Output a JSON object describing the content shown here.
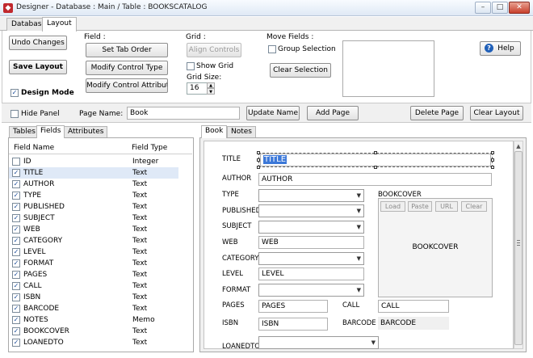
{
  "window": {
    "title": "Designer - Database : Main / Table : BOOKSCATALOG",
    "min": "–",
    "max": "□",
    "close": "✕"
  },
  "tabs": [
    {
      "label": "Database"
    },
    {
      "label": "Layout"
    }
  ],
  "ribbon": {
    "undo": "Undo Changes",
    "save": "Save Layout",
    "design_mode": "Design Mode",
    "field_group": "Field :",
    "set_tab_order": "Set Tab Order",
    "modify_control_type": "Modify Control Type",
    "modify_control_attributes": "Modify Control Attributes",
    "grid_group": "Grid :",
    "align_controls": "Align Controls",
    "show_grid": "Show Grid",
    "grid_size_label": "Grid Size:",
    "grid_size_value": "16",
    "move_group": "Move Fields :",
    "group_selection": "Group Selection",
    "clear_selection": "Clear Selection",
    "help": "Help"
  },
  "panelbar": {
    "hide_panel": "Hide Panel",
    "page_name_label": "Page Name:",
    "page_name_value": "Book",
    "update_name": "Update Name",
    "add_page": "Add Page",
    "delete_page": "Delete Page",
    "clear_layout": "Clear Layout"
  },
  "left_tabs": [
    {
      "label": "Tables"
    },
    {
      "label": "Fields"
    },
    {
      "label": "Attributes"
    }
  ],
  "fields_table": {
    "col_name": "Field Name",
    "col_type": "Field Type",
    "rows": [
      {
        "name": "ID",
        "type": "Integer",
        "checked": false
      },
      {
        "name": "TITLE",
        "type": "Text",
        "checked": true
      },
      {
        "name": "AUTHOR",
        "type": "Text",
        "checked": true
      },
      {
        "name": "TYPE",
        "type": "Text",
        "checked": true
      },
      {
        "name": "PUBLISHED",
        "type": "Text",
        "checked": true
      },
      {
        "name": "SUBJECT",
        "type": "Text",
        "checked": true
      },
      {
        "name": "WEB",
        "type": "Text",
        "checked": true
      },
      {
        "name": "CATEGORY",
        "type": "Text",
        "checked": true
      },
      {
        "name": "LEVEL",
        "type": "Text",
        "checked": true
      },
      {
        "name": "FORMAT",
        "type": "Text",
        "checked": true
      },
      {
        "name": "PAGES",
        "type": "Text",
        "checked": true
      },
      {
        "name": "CALL",
        "type": "Text",
        "checked": true
      },
      {
        "name": "ISBN",
        "type": "Text",
        "checked": true
      },
      {
        "name": "BARCODE",
        "type": "Text",
        "checked": true
      },
      {
        "name": "NOTES",
        "type": "Memo",
        "checked": true
      },
      {
        "name": "BOOKCOVER",
        "type": "Text",
        "checked": true
      },
      {
        "name": "LOANEDTO",
        "type": "Text",
        "checked": true
      }
    ]
  },
  "right_tabs": [
    {
      "label": "Book"
    },
    {
      "label": "Notes"
    }
  ],
  "form": {
    "title_label": "TITLE",
    "title_value": "TITLE",
    "author_label": "AUTHOR",
    "author_value": "AUTHOR",
    "type_label": "TYPE",
    "published_label": "PUBLISHED",
    "subject_label": "SUBJECT",
    "web_label": "WEB",
    "web_value": "WEB",
    "category_label": "CATEGORY",
    "level_label": "LEVEL",
    "level_value": "LEVEL",
    "format_label": "FORMAT",
    "pages_label": "PAGES",
    "pages_value": "PAGES",
    "isbn_label": "ISBN",
    "isbn_value": "ISBN",
    "call_label": "CALL",
    "call_value": "CALL",
    "barcode_label": "BARCODE",
    "barcode_value": "BARCODE",
    "loanedto_label": "LOANEDTO",
    "bookcover_label": "BOOKCOVER",
    "bookcover_placeholder": "BOOKCOVER",
    "load": "Load",
    "paste": "Paste",
    "url": "URL",
    "clear": "Clear"
  },
  "glyphs": {
    "check": "✓",
    "dropdown": "▼",
    "up": "▲",
    "down": "▼",
    "help_q": "?"
  }
}
